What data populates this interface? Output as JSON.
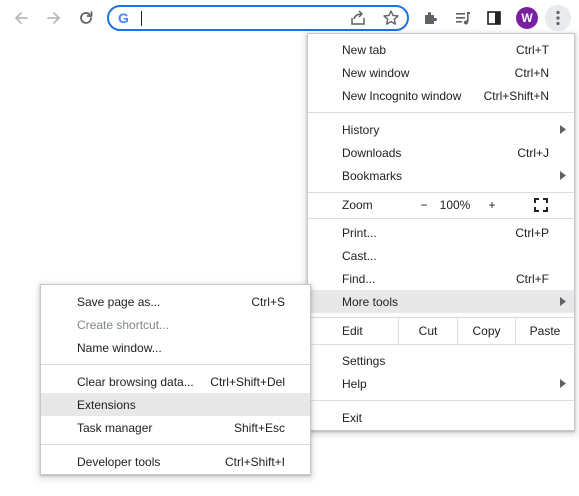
{
  "toolbar": {
    "back_icon": "arrow-left-icon",
    "forward_icon": "arrow-right-icon",
    "reload_icon": "reload-icon",
    "omnibox_value": "",
    "google_logo": "G",
    "share_icon": "share-icon",
    "bookmark_icon": "star-icon",
    "extensions_icon": "puzzle-icon",
    "media_icon": "media-control-icon",
    "side_panel_icon": "side-panel-icon",
    "avatar_letter": "W",
    "avatar_color": "#7b1fa2",
    "menu_icon": "three-dot-icon",
    "focus_color": "#1a73e8"
  },
  "main_menu": {
    "new_tab": {
      "label": "New tab",
      "shortcut": "Ctrl+T"
    },
    "new_window": {
      "label": "New window",
      "shortcut": "Ctrl+N"
    },
    "new_incognito": {
      "label": "New Incognito window",
      "shortcut": "Ctrl+Shift+N"
    },
    "history": {
      "label": "History"
    },
    "downloads": {
      "label": "Downloads",
      "shortcut": "Ctrl+J"
    },
    "bookmarks": {
      "label": "Bookmarks"
    },
    "zoom": {
      "label": "Zoom",
      "minus": "−",
      "value": "100%",
      "plus": "+"
    },
    "print": {
      "label": "Print...",
      "shortcut": "Ctrl+P"
    },
    "cast": {
      "label": "Cast..."
    },
    "find": {
      "label": "Find...",
      "shortcut": "Ctrl+F"
    },
    "more_tools": {
      "label": "More tools"
    },
    "edit": {
      "label": "Edit",
      "cut": "Cut",
      "copy": "Copy",
      "paste": "Paste"
    },
    "settings": {
      "label": "Settings"
    },
    "help": {
      "label": "Help"
    },
    "exit": {
      "label": "Exit"
    }
  },
  "more_tools_menu": {
    "save_page": {
      "label": "Save page as...",
      "shortcut": "Ctrl+S"
    },
    "create_shortcut": {
      "label": "Create shortcut..."
    },
    "name_window": {
      "label": "Name window..."
    },
    "clear_browsing": {
      "label": "Clear browsing data...",
      "shortcut": "Ctrl+Shift+Del"
    },
    "extensions": {
      "label": "Extensions"
    },
    "task_manager": {
      "label": "Task manager",
      "shortcut": "Shift+Esc"
    },
    "developer_tools": {
      "label": "Developer tools",
      "shortcut": "Ctrl+Shift+I"
    }
  }
}
